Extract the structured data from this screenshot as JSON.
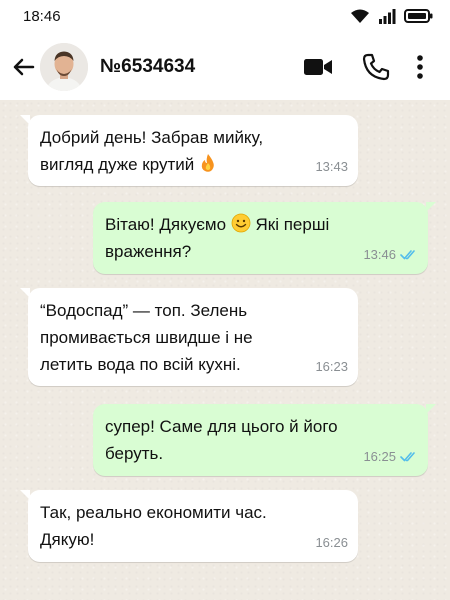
{
  "status_bar": {
    "time": "18:46"
  },
  "header": {
    "contact_name": "№6534634"
  },
  "colors": {
    "incoming_bubble": "#ffffff",
    "outgoing_bubble": "#d9fdd3",
    "read_ticks": "#53bdeb",
    "chat_background": "#efeae2"
  },
  "icons": [
    "wifi-icon",
    "signal-icon",
    "battery-icon",
    "back-arrow-icon",
    "video-call-icon",
    "phone-icon",
    "more-vert-icon",
    "read-receipt-icon",
    "fire-emoji-icon",
    "smile-emoji-icon"
  ],
  "messages": [
    {
      "direction": "in",
      "line1": "Добрий день! Забрав мийку,",
      "line2": "вигляд дуже крутий",
      "time": "13:43"
    },
    {
      "direction": "out",
      "line1_before": "Вітаю! Дякуємо",
      "line1_after": "Які перші",
      "line2": "враження?",
      "time": "13:46",
      "status": "read"
    },
    {
      "direction": "in",
      "line1": "“Водоспад” — топ. Зелень",
      "line2": "промивається швидше і не",
      "line3": "летить вода по всій кухні.",
      "time": "16:23"
    },
    {
      "direction": "out",
      "line1": "супер! Саме для цього й його",
      "line2": "беруть.",
      "time": "16:25",
      "status": "read"
    },
    {
      "direction": "in",
      "line1": "Так, реально економити час.",
      "line2": "Дякую!",
      "time": "16:26"
    }
  ]
}
